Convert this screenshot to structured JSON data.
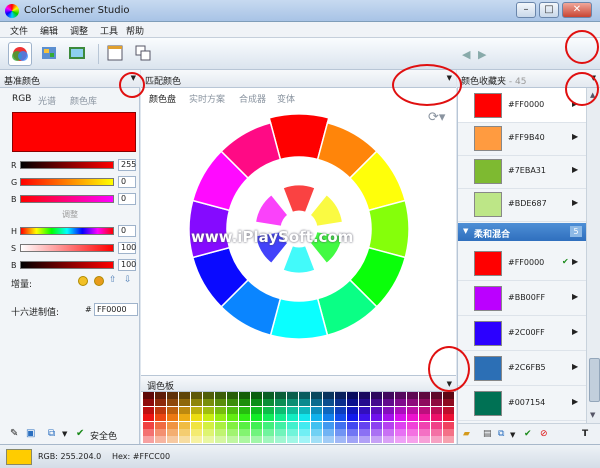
{
  "window": {
    "title": "ColorSchemer Studio",
    "buttons": [
      "–",
      "□",
      "✕"
    ]
  },
  "menu": [
    "文件",
    "编辑",
    "调整",
    "工具",
    "帮助"
  ],
  "toolbar": {
    "current_color_hex": "#FF0000",
    "current_color": "#FF0000"
  },
  "base_panel": {
    "title": "基准颜色",
    "tabs": [
      "RGB",
      "光谱",
      "颜色库"
    ],
    "swatch_color": "#FF0000",
    "rgb": {
      "r_label": "R",
      "r": "255",
      "g_label": "G",
      "g": "0",
      "b_label": "B",
      "b": "0"
    },
    "adjust_label": "调整",
    "hsb": {
      "h_label": "H",
      "h": "0",
      "s_label": "S",
      "s": "100",
      "b_label": "B",
      "b": "100"
    },
    "increment_label": "增量:",
    "hex_label": "十六进制值:",
    "hex_prefix": "#",
    "hex_value": "FF0000",
    "safe_color_label": "安全色"
  },
  "match_panel": {
    "title": "匹配颜色",
    "tabs": [
      "颜色盘",
      "实时方案",
      "合成器",
      "变体"
    ],
    "watermark": "www.iPlaySoft.com",
    "palette_title": "调色板"
  },
  "favorites_panel": {
    "title": "颜色收藏夹",
    "count_label": "- 45",
    "items": [
      {
        "hex": "#FF0000",
        "color": "#FF0000"
      },
      {
        "hex": "#FF9B40",
        "color": "#FF9B40"
      },
      {
        "hex": "#7EBA31",
        "color": "#7EBA31"
      },
      {
        "hex": "#BDE687",
        "color": "#BDE687"
      }
    ],
    "group": {
      "title": "柔和混合",
      "count": "5"
    },
    "group_items": [
      {
        "hex": "#FF0000",
        "color": "#FF0000"
      },
      {
        "hex": "#BB00FF",
        "color": "#BB00FF"
      },
      {
        "hex": "#2C00FF",
        "color": "#2C00FF"
      },
      {
        "hex": "#2C6FB5",
        "color": "#2C6FB5"
      },
      {
        "hex": "#007154",
        "color": "#007154"
      }
    ]
  },
  "status": {
    "swatch_color": "#FFCC00",
    "rgb_text": "RGB: 255.204.0",
    "hex_text": "Hex: #FFCC00"
  }
}
